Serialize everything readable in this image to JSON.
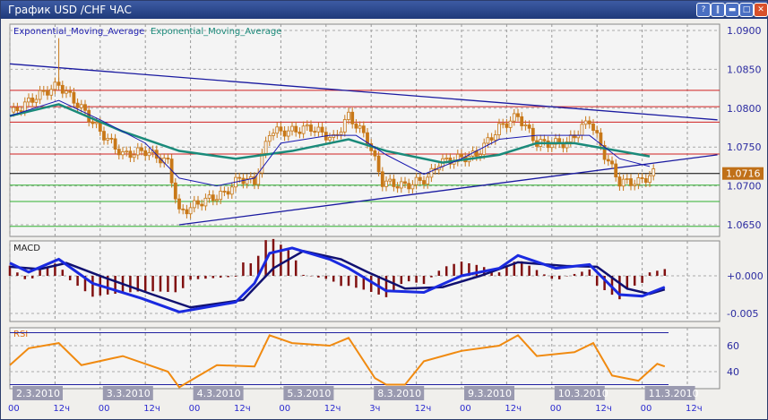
{
  "window": {
    "title": "График USD /CHF  ЧАС",
    "buttons": [
      "?",
      "pause",
      "minimize",
      "maximize",
      "close"
    ]
  },
  "chart_data": [
    {
      "type": "candlestick",
      "title": "USD/CHF H1",
      "legend": [
        "Exponential_Moving_Average",
        "Exponential_Moving_Average"
      ],
      "colors": {
        "candles": "#c87818",
        "ema_fast": "#1a1ab0",
        "ema_slow": "#1a8a7a",
        "trend": "#1a1aa0",
        "current": "#c07018"
      },
      "ylim": [
        1.0638,
        1.0908
      ],
      "yticks": [
        "1.0900",
        "1.0850",
        "1.0800",
        "1.0750",
        "1.0700",
        "1.0650"
      ],
      "current_price": "1.0716",
      "close": [
        [
          1,
          1.0795
        ],
        [
          7,
          1.0815
        ],
        [
          13,
          1.083
        ],
        [
          19,
          1.08
        ],
        [
          24,
          1.077
        ],
        [
          30,
          1.074
        ],
        [
          36,
          1.0745
        ],
        [
          42,
          1.073
        ],
        [
          45,
          1.0665
        ],
        [
          51,
          1.068
        ],
        [
          57,
          1.069
        ],
        [
          61,
          1.071
        ],
        [
          65,
          1.0705
        ],
        [
          69,
          1.077
        ],
        [
          74,
          1.077
        ],
        [
          80,
          1.0775
        ],
        [
          86,
          1.076
        ],
        [
          90,
          1.079
        ],
        [
          95,
          1.076
        ],
        [
          99,
          1.0705
        ],
        [
          105,
          1.07
        ],
        [
          111,
          1.071
        ],
        [
          114,
          1.073
        ],
        [
          119,
          1.0735
        ],
        [
          124,
          1.074
        ],
        [
          130,
          1.0775
        ],
        [
          135,
          1.079
        ],
        [
          140,
          1.0755
        ],
        [
          148,
          1.0755
        ],
        [
          154,
          1.0785
        ],
        [
          158,
          1.074
        ],
        [
          162,
          1.0705
        ],
        [
          167,
          1.0705
        ],
        [
          171,
          1.0716
        ]
      ],
      "high_spike": [
        13,
        1.089
      ],
      "ema_fast": [
        [
          0,
          1.079
        ],
        [
          13,
          1.081
        ],
        [
          24,
          1.0785
        ],
        [
          36,
          1.0755
        ],
        [
          45,
          1.071
        ],
        [
          55,
          1.07
        ],
        [
          65,
          1.071
        ],
        [
          72,
          1.0755
        ],
        [
          85,
          1.0765
        ],
        [
          92,
          1.0765
        ],
        [
          100,
          1.074
        ],
        [
          110,
          1.0715
        ],
        [
          120,
          1.0735
        ],
        [
          130,
          1.076
        ],
        [
          140,
          1.0765
        ],
        [
          154,
          1.0765
        ],
        [
          162,
          1.0735
        ],
        [
          170,
          1.0725
        ]
      ],
      "ema_slow": [
        [
          0,
          1.079
        ],
        [
          13,
          1.0805
        ],
        [
          30,
          1.077
        ],
        [
          45,
          1.0745
        ],
        [
          60,
          1.0735
        ],
        [
          75,
          1.0745
        ],
        [
          90,
          1.076
        ],
        [
          100,
          1.0745
        ],
        [
          115,
          1.073
        ],
        [
          130,
          1.074
        ],
        [
          140,
          1.0755
        ],
        [
          150,
          1.0755
        ],
        [
          170,
          1.0738
        ]
      ],
      "trendlines": [
        [
          [
            0,
            1.0857
          ],
          [
            188,
            1.0785
          ]
        ],
        [
          [
            45,
            1.065
          ],
          [
            188,
            1.074
          ]
        ]
      ],
      "levels": [
        {
          "v": 1.0823,
          "c": "#d02020"
        },
        {
          "v": 1.0802,
          "c": "#d02020"
        },
        {
          "v": 1.0782,
          "c": "#d02020"
        },
        {
          "v": 1.0741,
          "c": "#d02020"
        },
        {
          "v": 1.0716,
          "c": "#000000"
        },
        {
          "v": 1.0701,
          "c": "#30b030"
        },
        {
          "v": 1.068,
          "c": "#30b030"
        },
        {
          "v": 1.0648,
          "c": "#30b030"
        }
      ]
    },
    {
      "type": "line",
      "title": "MACD",
      "ylim": [
        -0.0065,
        0.0045
      ],
      "yticks": [
        "+0.000",
        "-0.005"
      ],
      "macd": [
        [
          0,
          0.0017
        ],
        [
          5,
          0.0005
        ],
        [
          13,
          0.0022
        ],
        [
          22,
          -0.001
        ],
        [
          35,
          -0.003
        ],
        [
          45,
          -0.0048
        ],
        [
          60,
          -0.0035
        ],
        [
          65,
          -0.001
        ],
        [
          69,
          0.003
        ],
        [
          75,
          0.0037
        ],
        [
          85,
          0.0022
        ],
        [
          90,
          0.001
        ],
        [
          100,
          -0.002
        ],
        [
          110,
          -0.0022
        ],
        [
          120,
          0
        ],
        [
          130,
          0.001
        ],
        [
          135,
          0.0027
        ],
        [
          145,
          0.001
        ],
        [
          154,
          0.0015
        ],
        [
          162,
          -0.0025
        ],
        [
          168,
          -0.0027
        ],
        [
          174,
          -0.0015
        ]
      ],
      "signal": [
        [
          0,
          0.0012
        ],
        [
          8,
          0.0009
        ],
        [
          15,
          0.0017
        ],
        [
          25,
          -0.0002
        ],
        [
          38,
          -0.0025
        ],
        [
          48,
          -0.0042
        ],
        [
          62,
          -0.0032
        ],
        [
          70,
          0.001
        ],
        [
          78,
          0.0033
        ],
        [
          88,
          0.0022
        ],
        [
          95,
          0.0005
        ],
        [
          105,
          -0.0017
        ],
        [
          115,
          -0.0015
        ],
        [
          125,
          0
        ],
        [
          135,
          0.0018
        ],
        [
          148,
          0.0013
        ],
        [
          156,
          0.0012
        ],
        [
          164,
          -0.0017
        ],
        [
          170,
          -0.0024
        ],
        [
          174,
          -0.0018
        ]
      ]
    },
    {
      "type": "line",
      "title": "RSI",
      "ylim": [
        25,
        75
      ],
      "yticks": [
        "60",
        "40"
      ],
      "levels": [
        70,
        30
      ],
      "values": [
        [
          0,
          45
        ],
        [
          5,
          58
        ],
        [
          13,
          62
        ],
        [
          19,
          45
        ],
        [
          30,
          52
        ],
        [
          42,
          40
        ],
        [
          45,
          28
        ],
        [
          55,
          45
        ],
        [
          65,
          44
        ],
        [
          69,
          68
        ],
        [
          75,
          62
        ],
        [
          85,
          60
        ],
        [
          90,
          66
        ],
        [
          97,
          35
        ],
        [
          100,
          30
        ],
        [
          105,
          30
        ],
        [
          110,
          48
        ],
        [
          120,
          56
        ],
        [
          130,
          60
        ],
        [
          135,
          68
        ],
        [
          140,
          52
        ],
        [
          150,
          55
        ],
        [
          155,
          62
        ],
        [
          160,
          37
        ],
        [
          167,
          33
        ],
        [
          172,
          46
        ],
        [
          174,
          44
        ]
      ]
    }
  ],
  "xaxis": {
    "dates": [
      "2.3.2010",
      "3.3.2010",
      "4.3.2010",
      "5.3.2010",
      "8.3.2010",
      "9.3.2010",
      "10.3.2010",
      "11.3.2010"
    ],
    "times": [
      "00",
      "12ч",
      "00",
      "12ч",
      "00",
      "12ч",
      "00",
      "12ч",
      "3ч",
      "12ч",
      "00",
      "12ч",
      "00",
      "12ч",
      "00",
      "12ч"
    ]
  }
}
